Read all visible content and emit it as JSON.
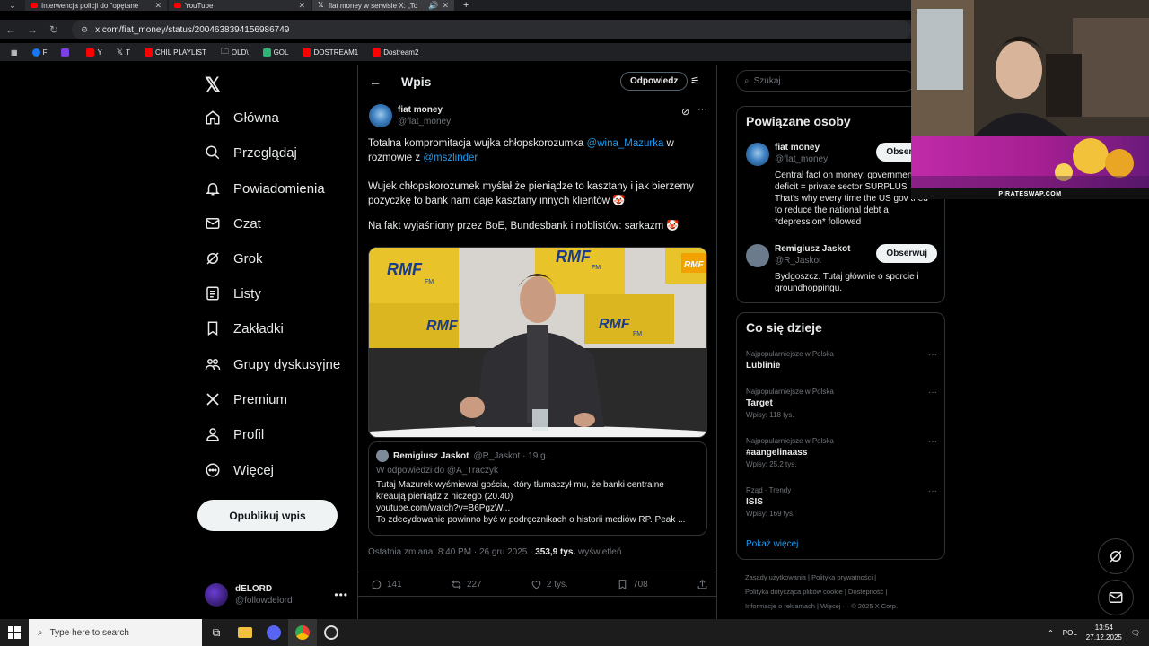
{
  "browser": {
    "tabs": [
      {
        "label": "Interwencja policji do \"opętane",
        "icon": "youtube-icon",
        "active": false
      },
      {
        "label": "YouTube",
        "icon": "youtube-icon",
        "active": false
      },
      {
        "label": "fiat money w serwisie X: „To",
        "icon": "x-icon",
        "active": true
      }
    ],
    "url": "x.com/fiat_money/status/2004638394156986749",
    "bookmarks": [
      {
        "label": "F",
        "color": "#1877f2"
      },
      {
        "label": "",
        "color": "#7b3fe4"
      },
      {
        "label": "Y",
        "color": "#ff0000"
      },
      {
        "label": "T",
        "color": "#ffffff"
      },
      {
        "label": "CHIL PLAYLIST",
        "color": "#ff0000"
      },
      {
        "label": "OLD\\",
        "color": "#cccccc"
      },
      {
        "label": "GOL",
        "color": "#2bb673"
      },
      {
        "label": "DOSTREAM1",
        "color": "#ff0000"
      },
      {
        "label": "Dostream2",
        "color": "#ff0000"
      }
    ]
  },
  "nav": {
    "items": [
      {
        "label": "Główna",
        "icon": "home-icon"
      },
      {
        "label": "Przeglądaj",
        "icon": "search-icon"
      },
      {
        "label": "Powiadomienia",
        "icon": "bell-icon"
      },
      {
        "label": "Czat",
        "icon": "mail-icon"
      },
      {
        "label": "Grok",
        "icon": "grok-icon"
      },
      {
        "label": "Listy",
        "icon": "list-icon"
      },
      {
        "label": "Zakładki",
        "icon": "bookmark-icon"
      },
      {
        "label": "Grupy dyskusyjne",
        "icon": "communities-icon"
      },
      {
        "label": "Premium",
        "icon": "x-icon"
      },
      {
        "label": "Profil",
        "icon": "profile-icon"
      },
      {
        "label": "Więcej",
        "icon": "more-icon"
      }
    ],
    "post_button": "Opublikuj wpis",
    "account": {
      "name": "dELORD",
      "handle": "@followdelord"
    }
  },
  "main": {
    "header_title": "Wpis",
    "reply_button": "Odpowiedz",
    "author": {
      "name": "fiat money",
      "handle": "@flat_money"
    },
    "text": {
      "p1_a": "Totalna kompromitacja wujka chłopskorozumka ",
      "p1_m1": "@wina_Mazurka",
      "p1_b": " w rozmowie z ",
      "p1_m2": "@mszlinder",
      "p2": "Wujek chłopskorozumek myślał że pieniądze to kasztany i jak bierzemy pożyczkę to bank nam daje kasztany innych klientów 🤡",
      "p3": "Na fakt wyjaśniony przez BoE, Bundesbank i noblistów: sarkazm 🤡"
    },
    "media": {
      "logo_text": "RMF",
      "logo_sub": "FM"
    },
    "quote": {
      "name": "Remigiusz Jaskot",
      "handle": "@R_Jaskot · 19 g.",
      "reply_to": "W odpowiedzi do @A_Traczyk",
      "line1": "Tutaj Mazurek wyśmiewał gościa, który tłumaczył mu, że banki centralne",
      "line2": "kreaują pieniądz z niczego (20.40)",
      "line3": "youtube.com/watch?v=B6PgzW...",
      "line4": "To zdecydowanie powinno być w podręcznikach o historii mediów RP. Peak ..."
    },
    "meta": {
      "time": "Ostatnia zmiana: 8:40 PM · 26 gru 2025 · ",
      "views_count": "353,9 tys.",
      "views_label": " wyświetleń"
    },
    "actions": {
      "replies": "141",
      "reposts": "227",
      "likes": "2 tys.",
      "bookmarks": "708"
    }
  },
  "right": {
    "search_placeholder": "Szukaj",
    "people_title": "Powiązane osoby",
    "people": [
      {
        "name": "fiat money",
        "handle": "@flat_money",
        "button": "Obserwuj",
        "bio": [
          "Central fact on money: government",
          "deficit = private sector SURPLUS",
          "That's why every time the US gov tried",
          "to reduce the national debt a",
          "*depression* followed"
        ]
      },
      {
        "name": "Remigiusz Jaskot",
        "handle": "@R_Jaskot",
        "button": "Obserwuj",
        "bio": [
          "Bydgoszcz. Tutaj głównie o sporcie i",
          "groundhoppingu."
        ]
      }
    ],
    "trends_title": "Co się dzieje",
    "trends": [
      {
        "category": "Najpopularniejsze w Polska",
        "name": "Lublinie",
        "posts": ""
      },
      {
        "category": "Najpopularniejsze w Polska",
        "name": "Target",
        "posts": "Wpisy: 118 tys."
      },
      {
        "category": "Najpopularniejsze w Polska",
        "name": "#aangelinaass",
        "posts": "Wpisy: 25,2 tys."
      },
      {
        "category": "Rząd · Trendy",
        "name": "ISIS",
        "posts": "Wpisy: 169 tys."
      }
    ],
    "show_more": "Pokaż więcej",
    "footer": {
      "line1": "Zasady użytkowania  |  Polityka prywatności  |",
      "line2": "Polityka dotycząca plików cookie  |  Dostępność  |",
      "line3": "Informacje o reklamach  |  Więcej ···  © 2025 X Corp."
    }
  },
  "overlay": {
    "promo_text": "PIRATESWAP.COM"
  },
  "taskbar": {
    "search_placeholder": "Type here to search",
    "lang": "POL",
    "time": "13:54",
    "date": "27.12.2025"
  }
}
